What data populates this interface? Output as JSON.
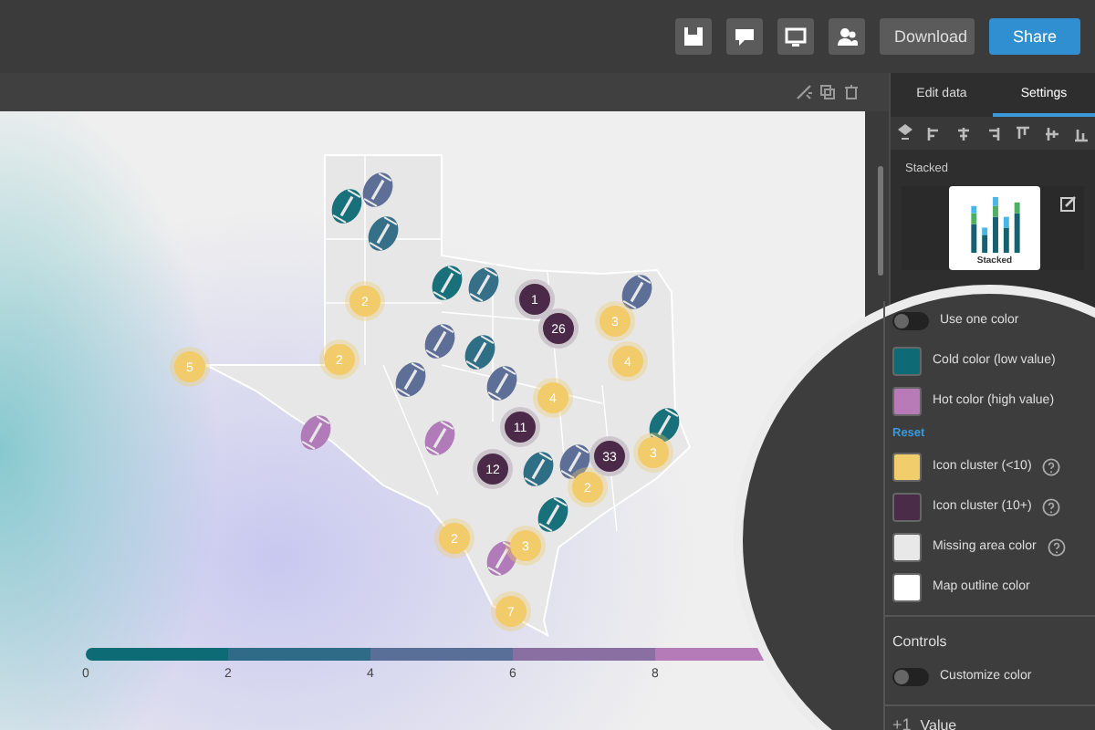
{
  "top_bar": {
    "buttons": [
      {
        "label": "Download",
        "primary": false
      },
      {
        "label": "Share",
        "primary": true
      }
    ]
  },
  "map": {
    "markers": [
      {
        "kind": "football",
        "color": "#17707a"
      },
      {
        "kind": "football",
        "color": "#5d6f97"
      },
      {
        "kind": "football",
        "color": "#356f88"
      },
      {
        "kind": "football",
        "color": "#17707a"
      },
      {
        "kind": "football",
        "color": "#356f88"
      },
      {
        "kind": "football",
        "color": "#5d6f97"
      },
      {
        "kind": "football",
        "color": "#5d6f97"
      },
      {
        "kind": "football",
        "color": "#2f6f86"
      },
      {
        "kind": "football",
        "color": "#5d6f97"
      },
      {
        "kind": "football",
        "color": "#5d6f97"
      },
      {
        "kind": "football",
        "color": "#b07bb8"
      },
      {
        "kind": "football",
        "color": "#b07bb8"
      },
      {
        "kind": "football",
        "color": "#17707a"
      },
      {
        "kind": "football",
        "color": "#5d6f97"
      },
      {
        "kind": "football",
        "color": "#2f6f86"
      },
      {
        "kind": "football",
        "color": "#17707a"
      },
      {
        "kind": "football",
        "color": "#b07bb8"
      },
      {
        "kind": "cluster",
        "label": "2",
        "color": "#f2cb6a"
      },
      {
        "kind": "cluster",
        "label": "5",
        "color": "#f2cb6a"
      },
      {
        "kind": "cluster",
        "label": "2",
        "color": "#f2cb6a"
      },
      {
        "kind": "cluster",
        "label": "3",
        "color": "#f2cb6a"
      },
      {
        "kind": "cluster",
        "label": "4",
        "color": "#f2cb6a"
      },
      {
        "kind": "cluster",
        "label": "4",
        "color": "#f2cb6a"
      },
      {
        "kind": "cluster",
        "label": "3",
        "color": "#f2cb6a"
      },
      {
        "kind": "cluster",
        "label": "2",
        "color": "#f2cb6a"
      },
      {
        "kind": "cluster",
        "label": "2",
        "color": "#f2cb6a"
      },
      {
        "kind": "cluster",
        "label": "3",
        "color": "#f2cb6a"
      },
      {
        "kind": "cluster",
        "label": "7",
        "color": "#f2cb6a"
      },
      {
        "kind": "cluster",
        "label": "1",
        "color": "#4a2a48"
      },
      {
        "kind": "cluster",
        "label": "26",
        "color": "#4a2a48"
      },
      {
        "kind": "cluster",
        "label": "11",
        "color": "#4a2a48"
      },
      {
        "kind": "cluster",
        "label": "12",
        "color": "#4a2a48"
      },
      {
        "kind": "cluster",
        "label": "33",
        "color": "#4a2a48"
      }
    ],
    "legend": {
      "segments": [
        {
          "color": "#0d6b75"
        },
        {
          "color": "#2f6a86"
        },
        {
          "color": "#5a6f98"
        },
        {
          "color": "#8a6fa3"
        },
        {
          "color": "#b57bb8"
        }
      ],
      "ticks": [
        "0",
        "2",
        "4",
        "6",
        "8"
      ]
    }
  },
  "panel": {
    "tabs": [
      {
        "label": "Edit data",
        "selected": false
      },
      {
        "label": "Settings",
        "selected": true
      }
    ],
    "section_label": "Stacked",
    "chart_type": "Stacked",
    "settings": [
      {
        "kind": "toggle",
        "label": "Use one color",
        "on": false
      },
      {
        "kind": "swatch",
        "label": "Cold color (low value)",
        "color": "#0e6b75",
        "help": false
      },
      {
        "kind": "swatch",
        "label": "Hot color (high value)",
        "color": "#b97ab8",
        "help": false
      },
      {
        "kind": "link",
        "label": "Reset"
      },
      {
        "kind": "swatch",
        "label": "Icon cluster (<10)",
        "color": "#f2cd6b",
        "help": true
      },
      {
        "kind": "swatch",
        "label": "Icon cluster (10+)",
        "color": "#4a2c48",
        "help": true
      },
      {
        "kind": "swatch",
        "label": "Missing area color",
        "color": "#e8e8e8",
        "help": true
      },
      {
        "kind": "swatch",
        "label": "Map outline color",
        "color": "#ffffff",
        "help": false
      }
    ],
    "controls": {
      "title": "Controls",
      "settings": [
        {
          "kind": "toggle",
          "label": "Customize color",
          "on": false
        }
      ]
    },
    "value_section": {
      "icon_text": "+1",
      "title": "Value"
    }
  }
}
